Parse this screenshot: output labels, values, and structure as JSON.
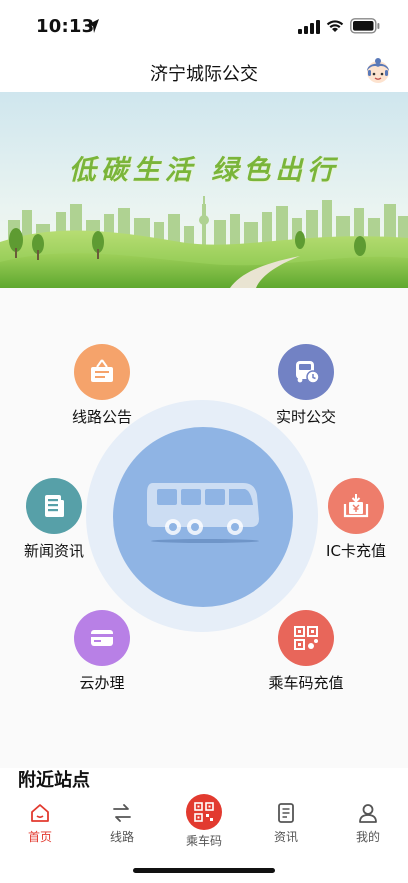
{
  "status": {
    "time": "10:13"
  },
  "header": {
    "title": "济宁城际公交"
  },
  "banner": {
    "slogan": "低碳生活 绿色出行"
  },
  "services": [
    {
      "label": "线路公告",
      "icon": "notice-board-icon",
      "color": "#f5a36b"
    },
    {
      "label": "实时公交",
      "icon": "bus-clock-icon",
      "color": "#7282c4"
    },
    {
      "label": "新闻资讯",
      "icon": "newspaper-icon",
      "color": "#57a0a8"
    },
    {
      "label": "IC卡充值",
      "icon": "card-recharge-icon",
      "color": "#ee7d6b"
    },
    {
      "label": "云办理",
      "icon": "card-icon",
      "color": "#b880e6"
    },
    {
      "label": "乘车码充值",
      "icon": "qr-bus-icon",
      "color": "#e8665a"
    }
  ],
  "nearby": {
    "title": "附近站点"
  },
  "tabs": [
    {
      "label": "首页",
      "icon": "home-icon"
    },
    {
      "label": "线路",
      "icon": "route-arrows-icon"
    },
    {
      "label": "乘车码",
      "icon": "qr-code-icon"
    },
    {
      "label": "资讯",
      "icon": "document-icon"
    },
    {
      "label": "我的",
      "icon": "user-icon"
    }
  ],
  "colors": {
    "accent": "#e23a2f",
    "hub": "#8fb4e4",
    "ring": "#e6eef8"
  }
}
